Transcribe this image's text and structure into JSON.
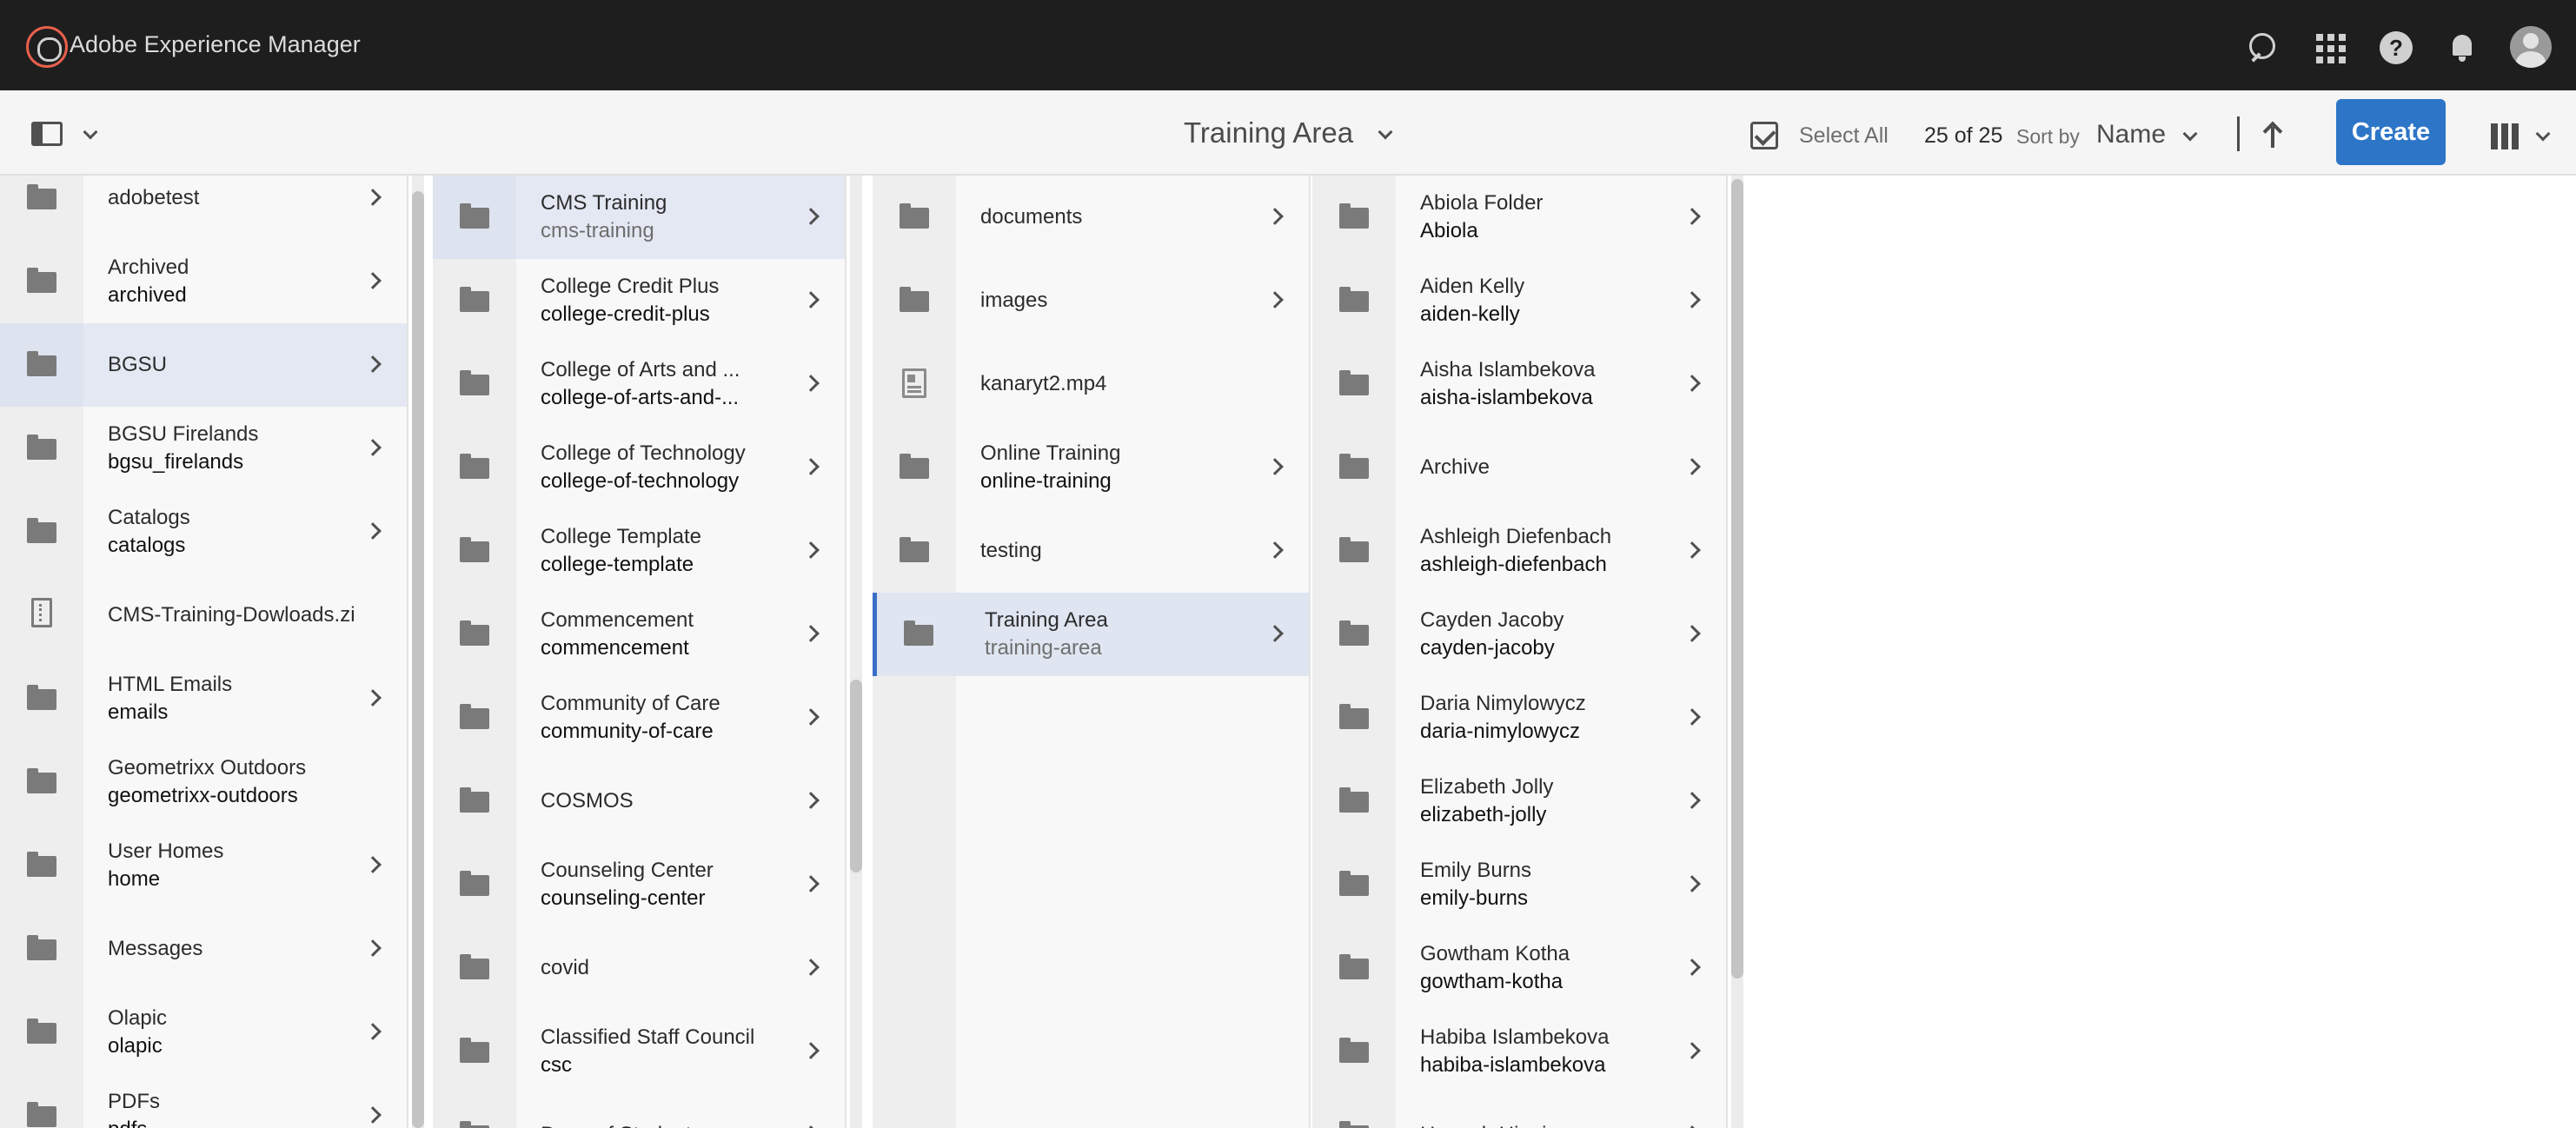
{
  "shell": {
    "brand": "Adobe Experience Manager",
    "help_glyph": "?"
  },
  "actionbar": {
    "title": "Training Area",
    "select_all": "Select All",
    "count": "25 of 25",
    "sort_by": "Sort by",
    "sort_value": "Name",
    "create": "Create"
  },
  "columns": [
    {
      "items": [
        {
          "title": "adobetest",
          "sub": "",
          "icon": "folder",
          "chevron": true
        },
        {
          "title": "Archived",
          "sub": "archived",
          "icon": "folder",
          "chevron": true
        },
        {
          "title": "BGSU",
          "sub": "",
          "icon": "folder",
          "chevron": true,
          "state": "active"
        },
        {
          "title": "BGSU Firelands",
          "sub": "bgsu_firelands",
          "icon": "folder",
          "chevron": true
        },
        {
          "title": "Catalogs",
          "sub": "catalogs",
          "icon": "folder",
          "chevron": true
        },
        {
          "title": "CMS-Training-Dowloads.zip",
          "sub": "",
          "icon": "file",
          "chevron": false
        },
        {
          "title": "HTML Emails",
          "sub": "emails",
          "icon": "folder",
          "chevron": true
        },
        {
          "title": "Geometrixx Outdoors",
          "sub": "geometrixx-outdoors",
          "icon": "folder",
          "chevron": false
        },
        {
          "title": "User Homes",
          "sub": "home",
          "icon": "folder",
          "chevron": true
        },
        {
          "title": "Messages",
          "sub": "",
          "icon": "folder",
          "chevron": true
        },
        {
          "title": "Olapic",
          "sub": "olapic",
          "icon": "folder",
          "chevron": true
        },
        {
          "title": "PDFs",
          "sub": "pdfs",
          "icon": "folder",
          "chevron": true
        }
      ]
    },
    {
      "items": [
        {
          "title": "CMS Training",
          "sub": "cms-training",
          "icon": "folder",
          "chevron": true,
          "state": "active"
        },
        {
          "title": "College Credit Plus",
          "sub": "college-credit-plus",
          "icon": "folder",
          "chevron": true
        },
        {
          "title": "College of Arts and ...",
          "sub": "college-of-arts-and-...",
          "icon": "folder",
          "chevron": true
        },
        {
          "title": "College of Technology",
          "sub": "college-of-technology",
          "icon": "folder",
          "chevron": true
        },
        {
          "title": "College Template",
          "sub": "college-template",
          "icon": "folder",
          "chevron": true
        },
        {
          "title": "Commencement",
          "sub": "commencement",
          "icon": "folder",
          "chevron": true
        },
        {
          "title": "Community of Care",
          "sub": "community-of-care",
          "icon": "folder",
          "chevron": true
        },
        {
          "title": "COSMOS",
          "sub": "",
          "icon": "folder",
          "chevron": true
        },
        {
          "title": "Counseling Center",
          "sub": "counseling-center",
          "icon": "folder",
          "chevron": true
        },
        {
          "title": "covid",
          "sub": "",
          "icon": "folder",
          "chevron": true
        },
        {
          "title": "Classified Staff Council",
          "sub": "csc",
          "icon": "folder",
          "chevron": true
        },
        {
          "title": "Dean of Students",
          "sub": "",
          "icon": "folder",
          "chevron": true
        }
      ]
    },
    {
      "items": [
        {
          "title": "documents",
          "sub": "",
          "icon": "folder",
          "chevron": true
        },
        {
          "title": "images",
          "sub": "",
          "icon": "folder",
          "chevron": true
        },
        {
          "title": "kanaryt2.mp4",
          "sub": "",
          "icon": "video",
          "chevron": false
        },
        {
          "title": "Online Training",
          "sub": "online-training",
          "icon": "folder",
          "chevron": true
        },
        {
          "title": "testing",
          "sub": "",
          "icon": "folder",
          "chevron": true
        },
        {
          "title": "Training Area",
          "sub": "training-area",
          "icon": "folder",
          "chevron": true,
          "state": "selected"
        }
      ]
    },
    {
      "items": [
        {
          "title": "Abiola Folder",
          "sub": "Abiola",
          "icon": "folder",
          "chevron": true
        },
        {
          "title": "Aiden Kelly",
          "sub": "aiden-kelly",
          "icon": "folder",
          "chevron": true
        },
        {
          "title": "Aisha Islambekova",
          "sub": "aisha-islambekova",
          "icon": "folder",
          "chevron": true
        },
        {
          "title": "Archive",
          "sub": "",
          "icon": "folder",
          "chevron": true
        },
        {
          "title": "Ashleigh Diefenbach",
          "sub": "ashleigh-diefenbach",
          "icon": "folder",
          "chevron": true
        },
        {
          "title": "Cayden Jacoby",
          "sub": "cayden-jacoby",
          "icon": "folder",
          "chevron": true
        },
        {
          "title": "Daria Nimylowycz",
          "sub": "daria-nimylowycz",
          "icon": "folder",
          "chevron": true
        },
        {
          "title": "Elizabeth Jolly",
          "sub": "elizabeth-jolly",
          "icon": "folder",
          "chevron": true
        },
        {
          "title": "Emily Burns",
          "sub": "emily-burns",
          "icon": "folder",
          "chevron": true
        },
        {
          "title": "Gowtham Kotha",
          "sub": "gowtham-kotha",
          "icon": "folder",
          "chevron": true
        },
        {
          "title": "Habiba Islambekova",
          "sub": "habiba-islambekova",
          "icon": "folder",
          "chevron": true
        },
        {
          "title": "Hannah Higgins",
          "sub": "",
          "icon": "folder",
          "chevron": true
        }
      ]
    }
  ]
}
